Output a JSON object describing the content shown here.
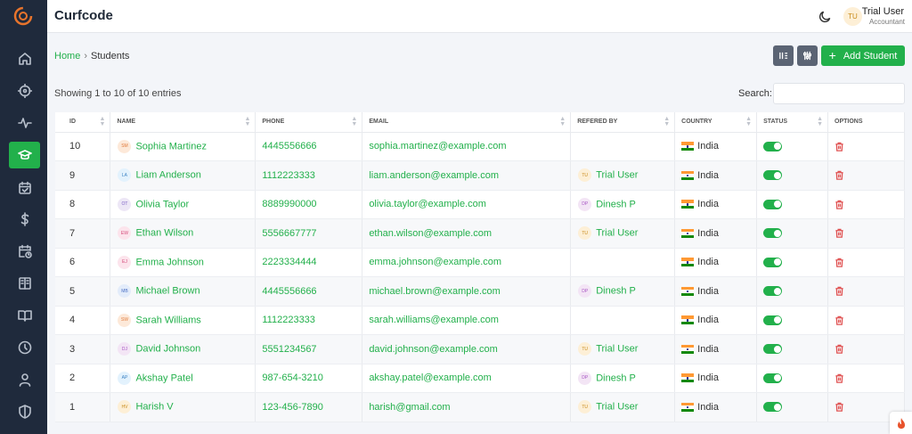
{
  "app": {
    "title": "Curfcode"
  },
  "user": {
    "name": "Trial User",
    "role": "Accountant",
    "initials": "TU"
  },
  "breadcrumb": {
    "home": "Home",
    "separator": "›",
    "current": "Students"
  },
  "toolbar": {
    "add_label": "Add Student",
    "columns_icon": "columns-icon",
    "filter_icon": "sliders-icon"
  },
  "table_info": {
    "entries_text": "Showing 1 to 10 of 10 entries",
    "search_label": "Search:",
    "search_value": ""
  },
  "sidebar": {
    "items": [
      "home-icon",
      "target-icon",
      "activity-icon",
      "graduation-cap-icon",
      "calendar-check-icon",
      "dollar-icon",
      "calendar-clock-icon",
      "book-open-icon",
      "book-icon",
      "clock-icon",
      "user-icon",
      "shield-icon"
    ],
    "active": "graduation-cap-icon"
  },
  "colors": {
    "accent": "#22b04b",
    "sidebar": "#1f2a3c",
    "delete": "#e05252"
  },
  "columns": [
    "ID",
    "NAME",
    "PHONE",
    "EMAIL",
    "REFERED BY",
    "COUNTRY",
    "STATUS",
    "OPTIONS"
  ],
  "students": [
    {
      "id": "10",
      "initials": "SM",
      "name": "Sophia Martinez",
      "phone": "4445556666",
      "email": "sophia.martinez@example.com",
      "ref_initials": "",
      "referred_by": "",
      "country": "India",
      "status": true
    },
    {
      "id": "9",
      "initials": "LA",
      "name": "Liam Anderson",
      "phone": "1112223333",
      "email": "liam.anderson@example.com",
      "ref_initials": "TU",
      "referred_by": "Trial User",
      "country": "India",
      "status": true
    },
    {
      "id": "8",
      "initials": "OT",
      "name": "Olivia Taylor",
      "phone": "8889990000",
      "email": "olivia.taylor@example.com",
      "ref_initials": "DP",
      "referred_by": "Dinesh P",
      "country": "India",
      "status": true
    },
    {
      "id": "7",
      "initials": "EW",
      "name": "Ethan Wilson",
      "phone": "5556667777",
      "email": "ethan.wilson@example.com",
      "ref_initials": "TU",
      "referred_by": "Trial User",
      "country": "India",
      "status": true
    },
    {
      "id": "6",
      "initials": "EJ",
      "name": "Emma Johnson",
      "phone": "2223334444",
      "email": "emma.johnson@example.com",
      "ref_initials": "",
      "referred_by": "",
      "country": "India",
      "status": true
    },
    {
      "id": "5",
      "initials": "MB",
      "name": "Michael Brown",
      "phone": "4445556666",
      "email": "michael.brown@example.com",
      "ref_initials": "DP",
      "referred_by": "Dinesh P",
      "country": "India",
      "status": true
    },
    {
      "id": "4",
      "initials": "SW",
      "name": "Sarah Williams",
      "phone": "1112223333",
      "email": "sarah.williams@example.com",
      "ref_initials": "",
      "referred_by": "",
      "country": "India",
      "status": true
    },
    {
      "id": "3",
      "initials": "DJ",
      "name": "David Johnson",
      "phone": "5551234567",
      "email": "david.johnson@example.com",
      "ref_initials": "TU",
      "referred_by": "Trial User",
      "country": "India",
      "status": true
    },
    {
      "id": "2",
      "initials": "AP",
      "name": "Akshay Patel",
      "phone": "987-654-3210",
      "email": "akshay.patel@example.com",
      "ref_initials": "DP",
      "referred_by": "Dinesh P",
      "country": "India",
      "status": true
    },
    {
      "id": "1",
      "initials": "HV",
      "name": "Harish V",
      "phone": "123-456-7890",
      "email": "harish@gmail.com",
      "ref_initials": "TU",
      "referred_by": "Trial User",
      "country": "India",
      "status": true
    }
  ]
}
